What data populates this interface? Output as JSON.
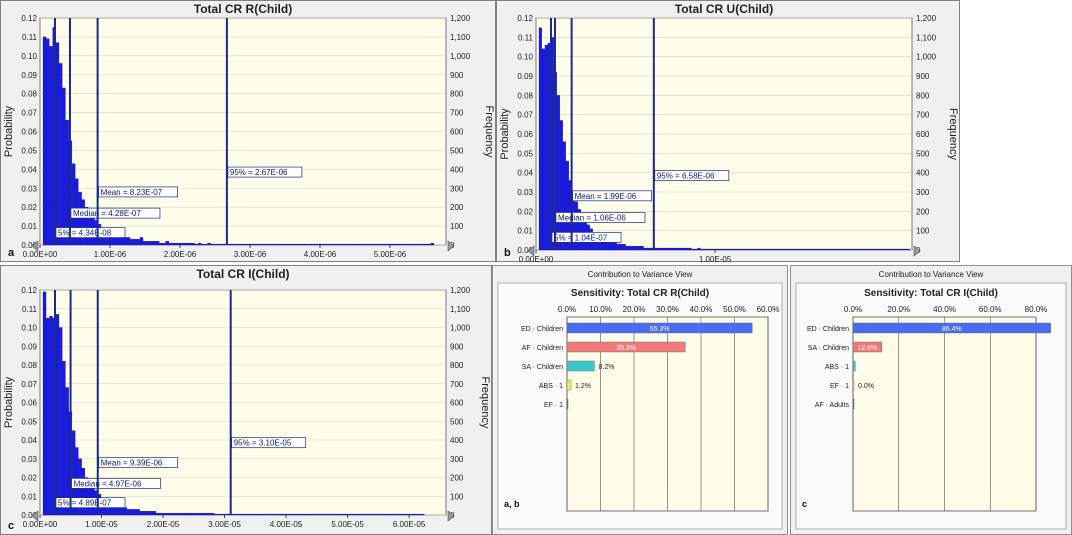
{
  "histograms": [
    {
      "title": "Total CR R(Child)",
      "panel_label": "a",
      "ylabel": "Probability",
      "y2label": "Frequency",
      "left_ticks": [
        "0.12",
        "0.11",
        "0.10",
        "0.09",
        "0.08",
        "0.07",
        "0.06",
        "0.05",
        "0.04",
        "0.03",
        "0.02",
        "0.01",
        "0.00"
      ],
      "right_ticks": [
        "1,200",
        "1,100",
        "1,000",
        "900",
        "800",
        "700",
        "600",
        "500",
        "400",
        "300",
        "200",
        "100",
        "0"
      ],
      "x_ticks": [
        "0.00E+00",
        "1.00E-06",
        "2.00E-06",
        "3.00E-06",
        "4.00E-06",
        "5.00E-06"
      ],
      "markers": {
        "mean": "Mean = 8.23E-07",
        "median": "Median = 4.28E-07",
        "p5": "5% = 4.34E-08",
        "p95": "95% = 2.67E-06"
      }
    },
    {
      "title": "Total CR U(Child)",
      "panel_label": "b",
      "ylabel": "Probability",
      "y2label": "Frequency",
      "left_ticks": [
        "0.12",
        "0.11",
        "0.10",
        "0.09",
        "0.08",
        "0.07",
        "0.06",
        "0.05",
        "0.04",
        "0.03",
        "0.02",
        "0.01",
        "0.00"
      ],
      "right_ticks": [
        "1,200",
        "1,100",
        "1,000",
        "900",
        "800",
        "700",
        "600",
        "500",
        "400",
        "300",
        "200",
        "100",
        "0"
      ],
      "x_ticks": [
        "0.00E+00",
        "1.00E-05"
      ],
      "markers": {
        "mean": "Mean = 1.99E-06",
        "median": "Median = 1.06E-06",
        "p5": "5% = 1.04E-07",
        "p95": "95% = 6.58E-06"
      }
    },
    {
      "title": "Total CR I(Child)",
      "panel_label": "c",
      "ylabel": "Probability",
      "y2label": "Frequency",
      "left_ticks": [
        "0.12",
        "0.11",
        "0.10",
        "0.09",
        "0.08",
        "0.07",
        "0.06",
        "0.05",
        "0.04",
        "0.03",
        "0.02",
        "0.01",
        "0.00"
      ],
      "right_ticks": [
        "1,200",
        "1,100",
        "1,000",
        "900",
        "800",
        "700",
        "600",
        "500",
        "400",
        "300",
        "200",
        "100",
        "0"
      ],
      "x_ticks": [
        "0.00E+00",
        "1.00E-05",
        "2.00E-05",
        "3.00E-05",
        "4.00E-05",
        "5.00E-05",
        "6.00E-05"
      ],
      "markers": {
        "mean": "Mean = 9.39E-06",
        "median": "Median = 4.97E-06",
        "p5": "5% = 4.89E-07",
        "p95": "95% = 3.10E-05"
      }
    }
  ],
  "sensitivity": [
    {
      "header": "Contribution to Variance View",
      "title": "Sensitivity: Total CR R(Child)",
      "panel_label": "a, b",
      "x_ticks": [
        "0.0%",
        "10.0%",
        "20.0%",
        "30.0%",
        "40.0%",
        "50.0%",
        "60.0%"
      ],
      "bars": [
        {
          "label": "ED · Children",
          "value_text": "55.3%"
        },
        {
          "label": "AF · Children",
          "value_text": "35.3%"
        },
        {
          "label": "SA · Children",
          "value_text": "8.2%"
        },
        {
          "label": "ABS · 1",
          "value_text": "1.2%"
        },
        {
          "label": "EF · 1",
          "value_text": ""
        }
      ]
    },
    {
      "header": "Contribution to Variance View",
      "title": "Sensitivity: Total CR I(Child)",
      "panel_label": "c",
      "x_ticks": [
        "0.0%",
        "20.0%",
        "40.0%",
        "60.0%",
        "80.0%"
      ],
      "bars": [
        {
          "label": "ED · Children",
          "value_text": "86.4%"
        },
        {
          "label": "SA · Children",
          "value_text": "12.6%"
        },
        {
          "label": "ABS · 1",
          "value_text": ""
        },
        {
          "label": "EF · 1",
          "value_text": "0.0%"
        },
        {
          "label": "AF · Adults",
          "value_text": ""
        }
      ]
    }
  ],
  "colors": {
    "bar_blue": "#1a1ae6",
    "marker_navy": "#1c2a8c",
    "plot_bg": "#fdfdea",
    "panel_bg": "#f0f0f0",
    "sens_blue": "#4a6cf0",
    "sens_red": "#f07a7a",
    "sens_teal": "#3cc8c8",
    "sens_yellow": "#f0f040"
  },
  "chart_data": [
    {
      "type": "bar",
      "title": "Total CR R(Child)",
      "xlabel": "",
      "ylabel": "Probability",
      "ylim": [
        0,
        0.12
      ],
      "xlim": [
        0,
        5.8e-06
      ],
      "markers": {
        "p5": 4.34e-08,
        "median": 4.28e-07,
        "mean": 8.23e-07,
        "p95": 2.67e-06
      },
      "values": [
        0.11,
        0.109,
        0.105,
        0.115,
        0.107,
        0.096,
        0.083,
        0.066,
        0.055,
        0.043,
        0.035,
        0.028,
        0.024,
        0.02,
        0.017,
        0.015,
        0.013,
        0.011,
        0.009,
        0.008,
        0.007,
        0.006,
        0.005,
        0.006,
        0.005,
        0.004,
        0.004,
        0.003,
        0.003,
        0.003,
        0.004,
        0.002,
        0.002,
        0.002,
        0.002,
        0.002,
        0.001,
        0.001,
        0.002,
        0.001,
        0.001,
        0.001,
        0.001,
        0.001,
        0.001,
        0.001,
        0.001,
        0.0005,
        0.001,
        0.0005,
        0.0005,
        0.001,
        0.0005,
        0.0005,
        0.0005,
        0.0005,
        0.0005,
        0.0005,
        0.0005,
        0.0005,
        0.0005,
        0.0005,
        0.0005,
        0.0005,
        0.0005,
        0.0005,
        0.0005,
        0.0005,
        0.0005,
        0.0005,
        0.0005,
        0.0005,
        0.0005,
        0.0005,
        0.0005,
        0.0005,
        0.0005,
        0.0005,
        0.0005,
        0.0005,
        0.0005,
        0.0005,
        0.0005,
        0.0005,
        0.0005,
        0.0005,
        0.0005,
        0.0005,
        0.0005,
        0.0005,
        0.0005,
        0.0005,
        0.0005,
        0.0005,
        0.0005,
        0.0005,
        0.0005,
        0.0005,
        0.0005,
        0.0005,
        0.0005,
        0.0005,
        0.0005,
        0.0005,
        0.0005,
        0.0005,
        0.0005,
        0.0005,
        0.0005,
        0.0005,
        0.0005,
        0.0005,
        0.0005,
        0.0005,
        0.0005,
        0.0005,
        0.0005,
        0.0005,
        0.0005,
        0.0005,
        0.001
      ]
    },
    {
      "type": "bar",
      "title": "Total CR U(Child)",
      "xlabel": "",
      "ylabel": "Probability",
      "ylim": [
        0,
        0.12
      ],
      "xlim": [
        0,
        2.1e-05
      ],
      "markers": {
        "p5": 1.04e-07,
        "median": 1.06e-06,
        "mean": 1.99e-06,
        "p95": 6.58e-06
      },
      "values": [
        0.115,
        0.104,
        0.106,
        0.107,
        0.11,
        0.092,
        0.08,
        0.067,
        0.056,
        0.046,
        0.036,
        0.03,
        0.025,
        0.021,
        0.018,
        0.015,
        0.013,
        0.011,
        0.009,
        0.008,
        0.007,
        0.006,
        0.005,
        0.005,
        0.004,
        0.004,
        0.003,
        0.003,
        0.003,
        0.002,
        0.002,
        0.002,
        0.002,
        0.002,
        0.002,
        0.001,
        0.001,
        0.001,
        0.001,
        0.001,
        0.001,
        0.001,
        0.001,
        0.001,
        0.001,
        0.001,
        0.001,
        0.001,
        0.001,
        0.001,
        0.001,
        0.0005,
        0.0005,
        0.001,
        0.0005,
        0.0005,
        0.0005,
        0.0005,
        0.0005,
        0.0005,
        0.0005,
        0.0005,
        0.0005,
        0.0005,
        0.0005,
        0.0005,
        0.0005,
        0.0005,
        0.0005,
        0.0005,
        0.0005,
        0.0005,
        0.0005,
        0.0005,
        0.0005,
        0.0005,
        0.0005,
        0.0005,
        0.0005,
        0.0005,
        0.0005,
        0.0005,
        0.0005,
        0.0005,
        0.0005,
        0.0005,
        0.0005,
        0.0005,
        0.0005,
        0.0005,
        0.0005,
        0.0005,
        0.0005,
        0.0005,
        0.0005,
        0.0005,
        0.0005,
        0.0005,
        0.0005,
        0.0005,
        0.0005,
        0.0005,
        0.0005,
        0.0005,
        0.0005,
        0.0005,
        0.0005,
        0.0005,
        0.0005,
        0.0005,
        0.0005,
        0.0005,
        0.0005,
        0.0005,
        0.0005,
        0.0005,
        0.0005,
        0.0005,
        0.0005,
        0.0005,
        0.0005,
        0.0005,
        0.0005,
        0.0005
      ]
    },
    {
      "type": "bar",
      "title": "Total CR I(Child)",
      "xlabel": "",
      "ylabel": "Probability",
      "ylim": [
        0,
        0.12
      ],
      "xlim": [
        0,
        6.6e-05
      ],
      "markers": {
        "p5": 4.89e-07,
        "median": 4.97e-06,
        "mean": 9.39e-06,
        "p95": 3.1e-05
      },
      "values": [
        0.119,
        0.105,
        0.106,
        0.105,
        0.107,
        0.1,
        0.082,
        0.068,
        0.055,
        0.045,
        0.036,
        0.03,
        0.025,
        0.02,
        0.017,
        0.015,
        0.013,
        0.011,
        0.009,
        0.008,
        0.007,
        0.006,
        0.006,
        0.005,
        0.004,
        0.004,
        0.003,
        0.003,
        0.003,
        0.003,
        0.002,
        0.002,
        0.002,
        0.002,
        0.002,
        0.001,
        0.001,
        0.001,
        0.001,
        0.001,
        0.001,
        0.001,
        0.001,
        0.001,
        0.001,
        0.001,
        0.001,
        0.001,
        0.001,
        0.001,
        0.001,
        0.001,
        0.001,
        0.0005,
        0.0005,
        0.0005,
        0.0005,
        0.0005,
        0.0005,
        0.0005,
        0.0005,
        0.0005,
        0.0005,
        0.0005,
        0.0005,
        0.0005,
        0.0005,
        0.0005,
        0.0005,
        0.0005,
        0.0005,
        0.0005,
        0.0005,
        0.0005,
        0.0005,
        0.0005,
        0.0005,
        0.0005,
        0.0005,
        0.0005,
        0.0005,
        0.0005,
        0.0005,
        0.0005,
        0.0005,
        0.0005,
        0.0005,
        0.0005,
        0.0005,
        0.0005,
        0.0005,
        0.0005,
        0.0005,
        0.0005,
        0.0005,
        0.0005,
        0.0005,
        0.0005,
        0.0005,
        0.0005,
        0.0005,
        0.0005,
        0.0005,
        0.0005,
        0.0005,
        0.0005,
        0.0005,
        0.0005,
        0.0005,
        0.0005,
        0.0005,
        0.0005,
        0.0005,
        0.0005,
        0.0005,
        0.0005,
        0.0005,
        0.0005
      ]
    },
    {
      "type": "bar",
      "orientation": "horizontal",
      "title": "Sensitivity: Total CR R(Child)",
      "categories": [
        "ED · Children",
        "AF · Children",
        "SA · Children",
        "ABS · 1",
        "EF · 1"
      ],
      "values": [
        55.3,
        35.3,
        8.2,
        1.2,
        0.0
      ],
      "xlim": [
        0,
        60
      ]
    },
    {
      "type": "bar",
      "orientation": "horizontal",
      "title": "Sensitivity: Total CR I(Child)",
      "categories": [
        "ED · Children",
        "SA · Children",
        "ABS · 1",
        "EF · 1",
        "AF · Adults"
      ],
      "values": [
        86.4,
        12.6,
        1.0,
        0.0,
        0.0
      ],
      "xlim": [
        0,
        80
      ]
    }
  ]
}
